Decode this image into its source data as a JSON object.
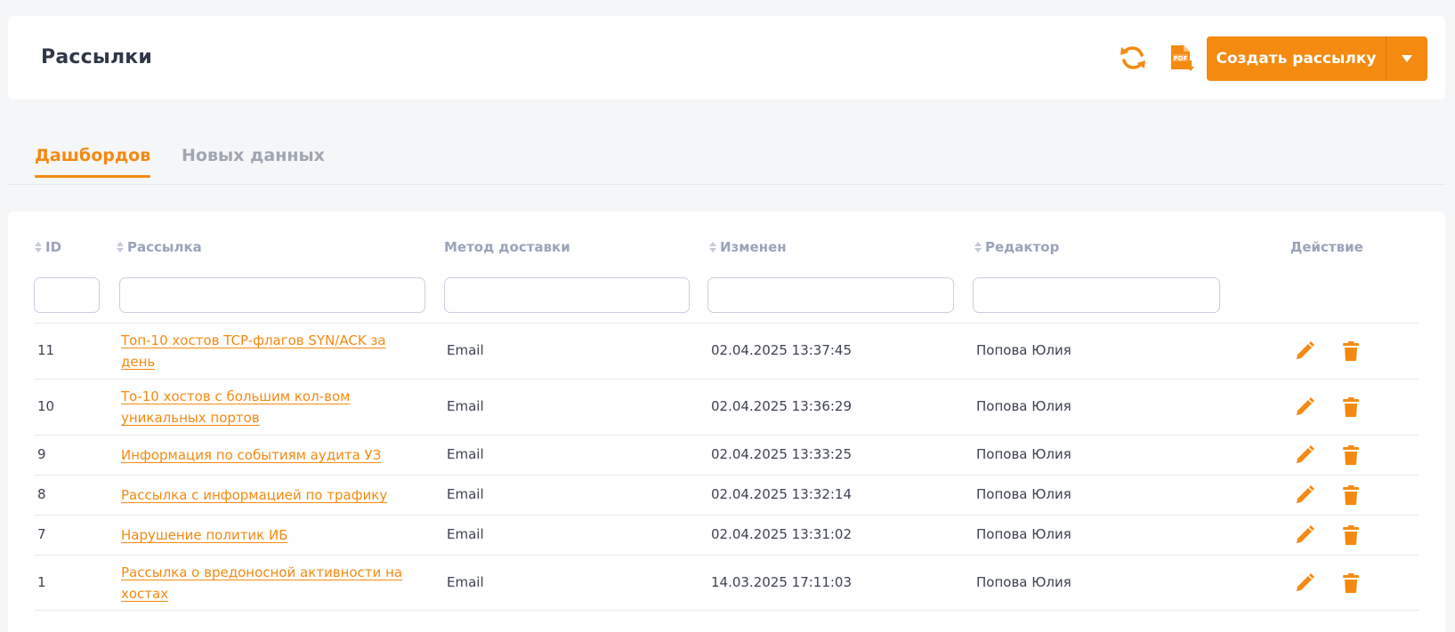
{
  "header": {
    "title": "Рассылки",
    "refresh_icon": "refresh-icon",
    "pdf_icon": "pdf-download-icon",
    "create_label": "Создать рассылку",
    "accent_color": "#f48a10"
  },
  "tabs": [
    {
      "label": "Дашбордов",
      "active": true
    },
    {
      "label": "Новых данных",
      "active": false
    }
  ],
  "table": {
    "columns": [
      {
        "label": "ID",
        "sortable": true
      },
      {
        "label": "Рассылка",
        "sortable": true
      },
      {
        "label": "Метод доставки",
        "sortable": false
      },
      {
        "label": "Изменен",
        "sortable": true
      },
      {
        "label": "Редактор",
        "sortable": true
      },
      {
        "label": "Действие",
        "sortable": false
      }
    ],
    "rows": [
      {
        "id": "11",
        "name_line1": "Топ-10 хостов TCP-флагов SYN/ACK за",
        "name_line2": "день",
        "method": "Email",
        "modified": "02.04.2025 13:37:45",
        "editor": "Попова Юлия"
      },
      {
        "id": "10",
        "name_line1": "То-10 хостов с большим кол-вом",
        "name_line2": "уникальных портов",
        "method": "Email",
        "modified": "02.04.2025 13:36:29",
        "editor": "Попова Юлия"
      },
      {
        "id": "9",
        "name_line1": "Информация по событиям аудита УЗ",
        "name_line2": "",
        "method": "Email",
        "modified": "02.04.2025 13:33:25",
        "editor": "Попова Юлия"
      },
      {
        "id": "8",
        "name_line1": "Рассылка с информацией по трафику",
        "name_line2": "",
        "method": "Email",
        "modified": "02.04.2025 13:32:14",
        "editor": "Попова Юлия"
      },
      {
        "id": "7",
        "name_line1": "Нарушение политик ИБ",
        "name_line2": "",
        "method": "Email",
        "modified": "02.04.2025 13:31:02",
        "editor": "Попова Юлия"
      },
      {
        "id": "1",
        "name_line1": "Рассылка о вредоносной активности на",
        "name_line2": "хостах",
        "method": "Email",
        "modified": "14.03.2025 17:11:03",
        "editor": "Попова Юлия"
      }
    ],
    "action_icons": [
      "edit-icon",
      "delete-icon"
    ]
  }
}
